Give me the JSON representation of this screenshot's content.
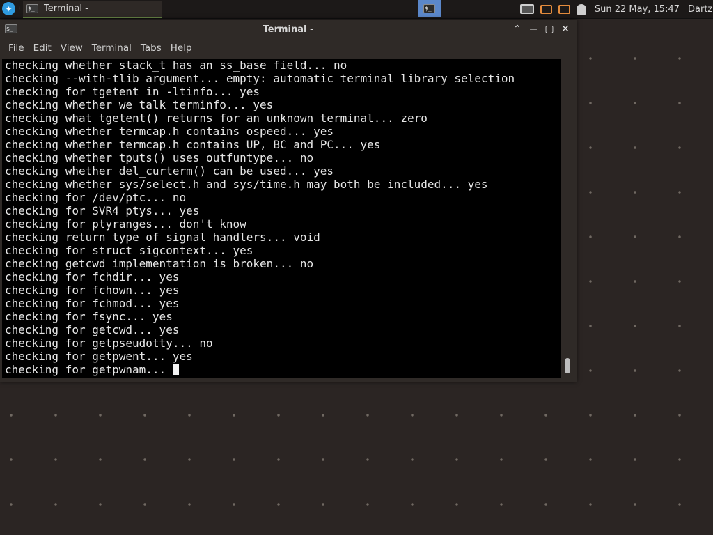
{
  "panel": {
    "menu_icon": "app-menu-icon",
    "taskbar_item_label": "Terminal -",
    "workspace_icon": "terminal-icon",
    "clock": "Sun 22 May, 15:47",
    "user": "Dartz"
  },
  "window": {
    "title": "Terminal -",
    "menu": {
      "file": "File",
      "edit": "Edit",
      "view": "View",
      "terminal": "Terminal",
      "tabs": "Tabs",
      "help": "Help"
    },
    "controls": {
      "maximize_up": "⌃",
      "minimize": "—",
      "restore": "▢",
      "close": "✕"
    }
  },
  "terminal": {
    "lines": [
      "checking whether stack_t has an ss_base field... no",
      "checking --with-tlib argument... empty: automatic terminal library selection",
      "checking for tgetent in -ltinfo... yes",
      "checking whether we talk terminfo... yes",
      "checking what tgetent() returns for an unknown terminal... zero",
      "checking whether termcap.h contains ospeed... yes",
      "checking whether termcap.h contains UP, BC and PC... yes",
      "checking whether tputs() uses outfuntype... no",
      "checking whether del_curterm() can be used... yes",
      "checking whether sys/select.h and sys/time.h may both be included... yes",
      "checking for /dev/ptc... no",
      "checking for SVR4 ptys... yes",
      "checking for ptyranges... don't know",
      "checking return type of signal handlers... void",
      "checking for struct sigcontext... yes",
      "checking getcwd implementation is broken... no",
      "checking for fchdir... yes",
      "checking for fchown... yes",
      "checking for fchmod... yes",
      "checking for fsync... yes",
      "checking for getcwd... yes",
      "checking for getpseudotty... no",
      "checking for getpwent... yes",
      "checking for getpwnam... "
    ]
  }
}
